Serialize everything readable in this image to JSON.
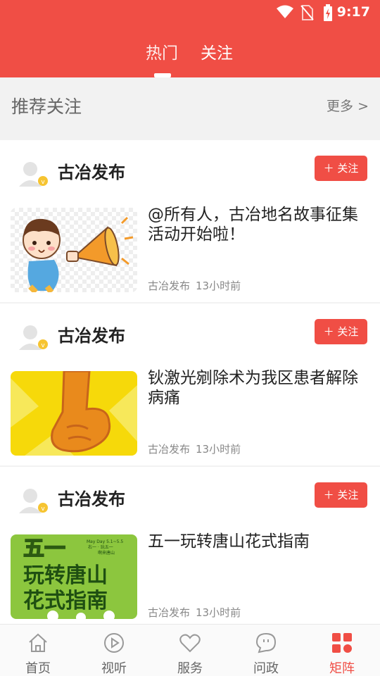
{
  "status_bar": {
    "time": "9:17"
  },
  "tabs": [
    {
      "label": "热门",
      "active": true
    },
    {
      "label": "关注",
      "active": false
    }
  ],
  "recommend": {
    "title": "推荐关注",
    "more": "更多 >"
  },
  "feed": [
    {
      "author": "古冶发布",
      "follow_label": "关注",
      "headline": "@所有人，古冶地名故事征集活动开始啦！",
      "source": "古冶发布",
      "time": "13小时前"
    },
    {
      "author": "古冶发布",
      "follow_label": "关注",
      "headline": "钬激光剜除术为我区患者解除病痛",
      "source": "古冶发布",
      "time": "13小时前"
    },
    {
      "author": "古冶发布",
      "follow_label": "关注",
      "headline": "五一玩转唐山花式指南",
      "source": "古冶发布",
      "time": "13小时前",
      "thumb_text": {
        "main1": "五一",
        "main2": "玩转唐山",
        "main3": "花式指南",
        "small1": "May Day 5.1~5.5",
        "small2": "右一 · 玩五一",
        "small3": "啊来唐山"
      }
    }
  ],
  "bottom_nav": [
    {
      "label": "首页",
      "icon": "home-icon",
      "active": false
    },
    {
      "label": "视听",
      "icon": "play-icon",
      "active": false
    },
    {
      "label": "服务",
      "icon": "heart-icon",
      "active": false
    },
    {
      "label": "问政",
      "icon": "chat-icon",
      "active": false
    },
    {
      "label": "矩阵",
      "icon": "matrix-icon",
      "active": true
    }
  ],
  "colors": {
    "brand": "#f04e45",
    "background": "#f2f2f2"
  }
}
